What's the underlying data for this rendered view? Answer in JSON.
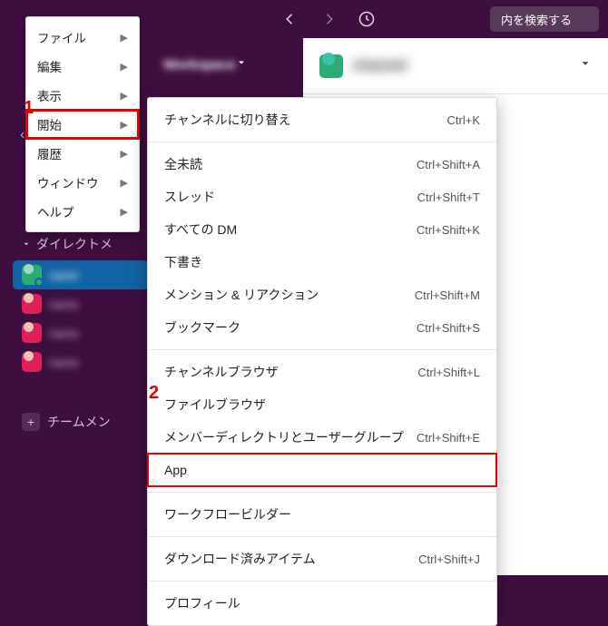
{
  "topbar": {
    "search_label": "内を検索する"
  },
  "workspace": {
    "name": "Workspace"
  },
  "channel": {
    "name": "channel"
  },
  "app_menu": {
    "items": [
      {
        "label": "ファイル"
      },
      {
        "label": "編集"
      },
      {
        "label": "表示"
      },
      {
        "label": "開始"
      },
      {
        "label": "履歴"
      },
      {
        "label": "ウィンドウ"
      },
      {
        "label": "ヘルプ"
      }
    ],
    "highlight_index": 3
  },
  "submenu": {
    "groups": [
      [
        {
          "label": "チャンネルに切り替え",
          "shortcut": "Ctrl+K"
        }
      ],
      [
        {
          "label": "全未読",
          "shortcut": "Ctrl+Shift+A"
        },
        {
          "label": "スレッド",
          "shortcut": "Ctrl+Shift+T"
        },
        {
          "label": "すべての DM",
          "shortcut": "Ctrl+Shift+K"
        },
        {
          "label": "下書き",
          "shortcut": ""
        },
        {
          "label": "メンション & リアクション",
          "shortcut": "Ctrl+Shift+M"
        },
        {
          "label": "ブックマーク",
          "shortcut": "Ctrl+Shift+S"
        }
      ],
      [
        {
          "label": "チャンネルブラウザ",
          "shortcut": "Ctrl+Shift+L"
        },
        {
          "label": "ファイルブラウザ",
          "shortcut": ""
        },
        {
          "label": "メンバーディレクトリとユーザーグループ",
          "shortcut": "Ctrl+Shift+E"
        },
        {
          "label": "App",
          "shortcut": "",
          "boxed": true
        }
      ],
      [
        {
          "label": "ワークフロービルダー",
          "shortcut": ""
        }
      ],
      [
        {
          "label": "ダウンロード済みアイテム",
          "shortcut": "Ctrl+Shift+J"
        }
      ],
      [
        {
          "label": "プロフィール",
          "shortcut": ""
        }
      ]
    ]
  },
  "sidebar": {
    "section_title": "ダイレクトメ",
    "add_label": "チームメン",
    "items": [
      {
        "color": "green",
        "label": "name",
        "active": true,
        "online": true
      },
      {
        "color": "pink",
        "label": "name"
      },
      {
        "color": "pink",
        "label": "name"
      },
      {
        "color": "pink",
        "label": "name"
      }
    ]
  },
  "markers": {
    "one": "1",
    "two": "2"
  }
}
